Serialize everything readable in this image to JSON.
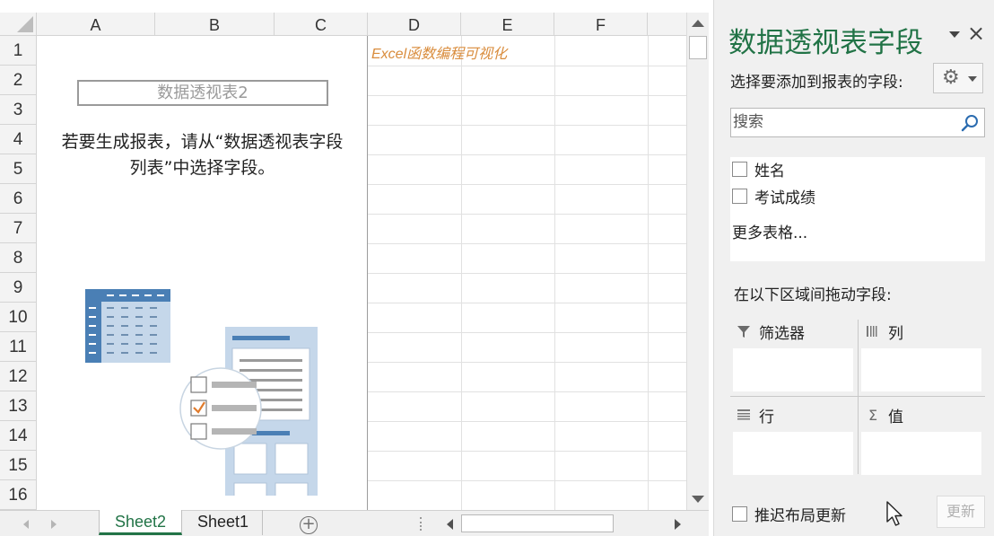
{
  "sheet": {
    "columns": [
      "A",
      "B",
      "C",
      "D",
      "E",
      "F"
    ],
    "rows": [
      "1",
      "2",
      "3",
      "4",
      "5",
      "6",
      "7",
      "8",
      "9",
      "10",
      "11",
      "12",
      "13",
      "14",
      "15",
      "16"
    ],
    "cell_d1": "Excel函数编程可视化",
    "pivot_placeholder": {
      "title": "数据透视表2",
      "instruction_line1": "若要生成报表，请从“数据透视表字段",
      "instruction_line2": "列表”中选择字段。"
    },
    "tabs": [
      {
        "label": "Sheet2",
        "active": true
      },
      {
        "label": "Sheet1",
        "active": false
      }
    ],
    "add_sheet_symbol": "+"
  },
  "pane": {
    "title": "数据透视表字段",
    "close_symbol": "×",
    "choose_fields_label": "选择要添加到报表的字段:",
    "settings_icon": "gear-icon",
    "search_placeholder": "搜索",
    "fields": [
      {
        "label": "姓名",
        "checked": false
      },
      {
        "label": "考试成绩",
        "checked": false
      }
    ],
    "more_tables": "更多表格...",
    "drag_label": "在以下区域间拖动字段:",
    "zones": {
      "filters": "筛选器",
      "columns": "列",
      "rows": "行",
      "values": "值"
    },
    "defer_update_label": "推迟布局更新",
    "update_button": "更新"
  },
  "colors": {
    "accent_green": "#217346",
    "d1_text": "#d98c3c",
    "illustration_blue": "#4a7fb5",
    "illustration_light": "#c5d7ea",
    "check_orange": "#e07b2c"
  }
}
